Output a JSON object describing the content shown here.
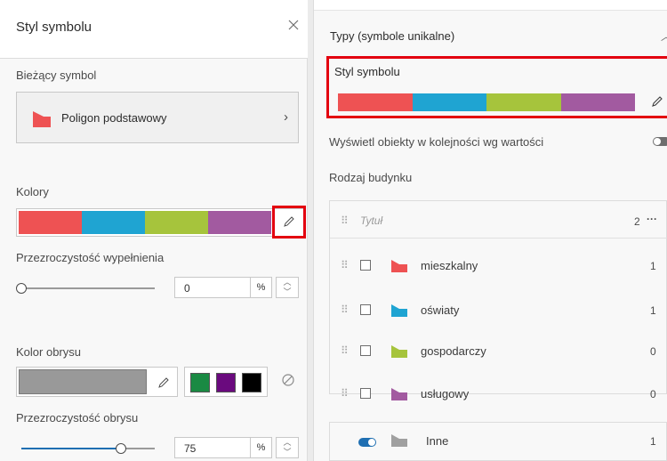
{
  "colors": {
    "red": "#ee5253",
    "blue": "#1fa4d2",
    "green": "#a6c43c",
    "purple": "#a25aa0",
    "outline_gray": "#999999",
    "preset_green": "#1a8a43",
    "preset_purple": "#6a0a7e",
    "preset_black": "#000000",
    "highlight_red": "#e3000f",
    "toggle_blue": "#1f6fb2",
    "other_gray": "#a0a0a0"
  },
  "left_panel": {
    "title": "Styl symbolu",
    "close_icon": "close-icon",
    "current_symbol": {
      "label": "Bieżący symbol",
      "symbol_name": "Poligon podstawowy",
      "chevron": "›"
    },
    "colors_label": "Kolory",
    "fill_transparency": {
      "label": "Przezroczystość wypełnienia",
      "value": "0",
      "unit": "%",
      "slider_fraction": 0
    },
    "outline_color": {
      "label": "Kolor obrysu"
    },
    "outline_transparency": {
      "label": "Przezroczystość obrysu",
      "value": "75",
      "unit": "%",
      "slider_fraction": 0.75
    }
  },
  "right_panel": {
    "section_title": "Typy (symbole unikalne)",
    "collapse_icon": "chevron-up-icon",
    "style_label": "Styl symbolu",
    "order_toggle_label": "Wyświetl obiekty w kolejności wg wartości",
    "order_toggle_on": false,
    "field_label": "Rodzaj budynku",
    "list_header": {
      "title_placeholder": "Tytuł",
      "count": "2",
      "more": "···"
    },
    "categories": [
      {
        "label": "mieszkalny",
        "count": "1",
        "color": "#ee5253"
      },
      {
        "label": "oświaty",
        "count": "1",
        "color": "#1fa4d2"
      },
      {
        "label": "gospodarczy",
        "count": "0",
        "color": "#a6c43c"
      },
      {
        "label": "usługowy",
        "count": "0",
        "color": "#a25aa0"
      }
    ],
    "other": {
      "label": "Inne",
      "count": "1",
      "enabled": true
    }
  }
}
